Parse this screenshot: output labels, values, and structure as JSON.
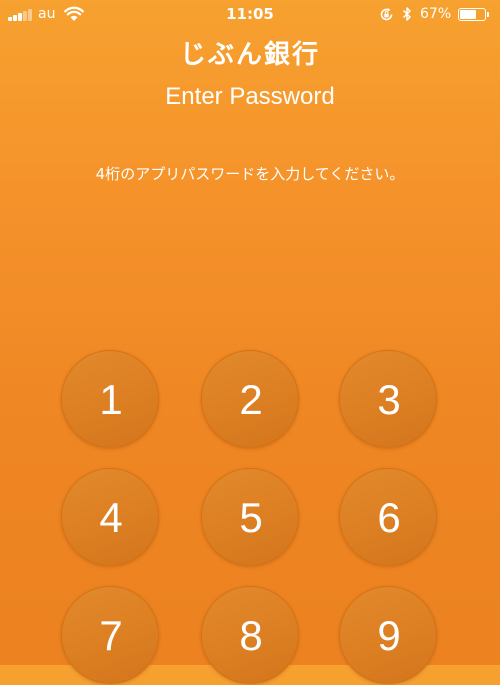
{
  "status_bar": {
    "carrier": "au",
    "time": "11:05",
    "battery_percent": "67%",
    "battery_level": 0.67,
    "signal_bars_filled": 3,
    "signal_bars_total": 5,
    "icons": [
      "wifi-icon",
      "rotation-lock-icon",
      "bluetooth-icon",
      "battery-icon"
    ]
  },
  "header": {
    "logo": "じぶん銀行",
    "title": "Enter Password"
  },
  "instruction": "4桁のアプリパスワードを入力してください。",
  "keypad": {
    "keys": [
      "1",
      "2",
      "3",
      "4",
      "5",
      "6",
      "7",
      "8",
      "9"
    ]
  },
  "colors": {
    "background": "#f5922a",
    "key_fill": "#dc7f22",
    "text": "#ffffff"
  }
}
